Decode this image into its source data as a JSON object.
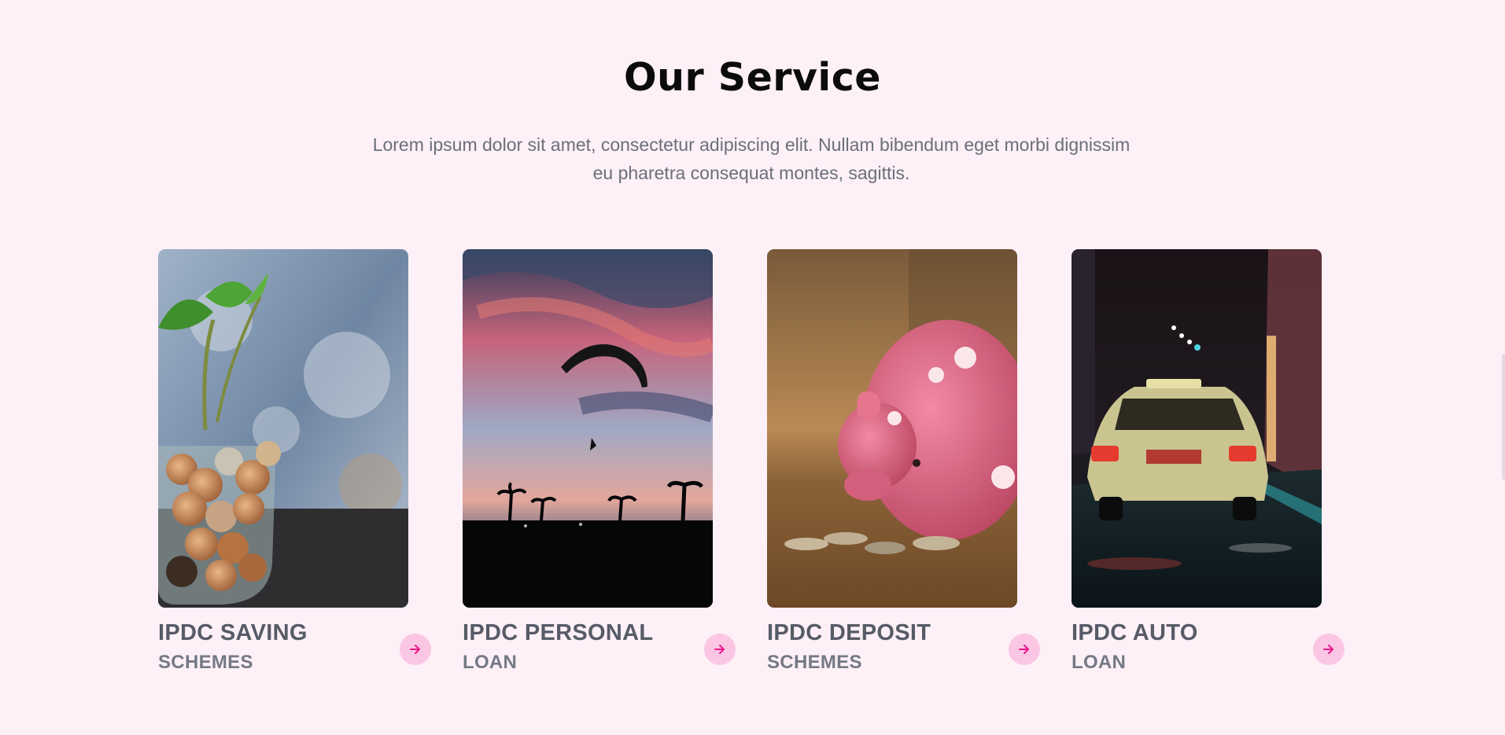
{
  "section": {
    "title": "Our Service",
    "description": "Lorem ipsum dolor sit amet, consectetur adipiscing elit. Nullam bibendum eget morbi dignissim eu pharetra consequat montes, sagittis."
  },
  "cards": [
    {
      "title": "IPDC SAVING",
      "subtitle": "SCHEMES",
      "image": "plant-growing-from-coin-jar",
      "icon": "arrow-right-icon"
    },
    {
      "title": "IPDC PERSONAL",
      "subtitle": "LOAN",
      "image": "paraglider-at-sunset",
      "icon": "arrow-right-icon"
    },
    {
      "title": "IPDC DEPOSIT",
      "subtitle": "SCHEMES",
      "image": "pink-piggy-bank-with-coins",
      "icon": "arrow-right-icon"
    },
    {
      "title": "IPDC AUTO",
      "subtitle": "LOAN",
      "image": "taxi-on-night-street",
      "icon": "arrow-right-icon"
    }
  ],
  "colors": {
    "background": "#fdf0f7",
    "accent": "#e8198b",
    "accent_soft": "#fbc6e3",
    "heading": "#0b0b0b",
    "card_title": "#565b66"
  }
}
